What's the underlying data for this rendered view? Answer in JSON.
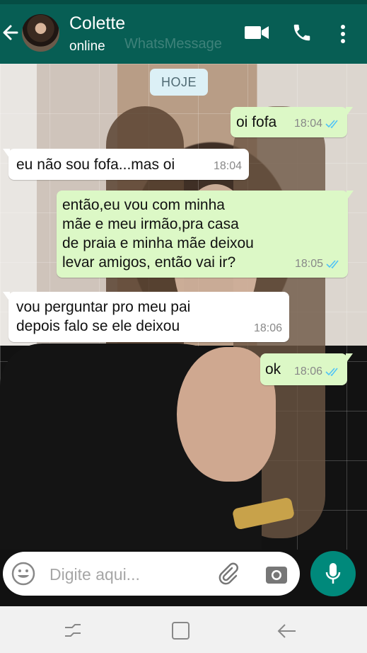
{
  "header": {
    "contact_name": "Colette",
    "status": "online",
    "watermark": "WhatsMessage",
    "icons": [
      "back-arrow-icon",
      "video-call-icon",
      "voice-call-icon",
      "more-options-icon"
    ]
  },
  "chat": {
    "date_chip": "HOJE",
    "messages": [
      {
        "direction": "out",
        "text": "oi fofa",
        "time": "18:04",
        "status": "read"
      },
      {
        "direction": "in",
        "text": "eu não sou fofa...mas oi",
        "time": "18:04"
      },
      {
        "direction": "out",
        "text": "então,eu vou com minha\nmãe e meu irmão,pra casa\nde praia e minha mãe deixou\nlevar amigos, então vai ir?",
        "time": "18:05",
        "status": "read"
      },
      {
        "direction": "in",
        "text": "vou perguntar pro meu pai\ndepois falo se ele deixou",
        "time": "18:06"
      },
      {
        "direction": "out",
        "text": "ok",
        "time": "18:06",
        "status": "read"
      }
    ]
  },
  "composer": {
    "placeholder": "Digite aqui...",
    "icons": [
      "emoji-icon",
      "attach-icon",
      "camera-icon",
      "mic-icon"
    ]
  },
  "navbar": {
    "icons": [
      "recent-apps-icon",
      "home-icon",
      "back-icon"
    ]
  },
  "colors": {
    "header": "#075e54",
    "outgoing_bubble": "#dcf8c6",
    "incoming_bubble": "#ffffff",
    "read_ticks": "#4fc3f7",
    "mic_button": "#00897b"
  }
}
